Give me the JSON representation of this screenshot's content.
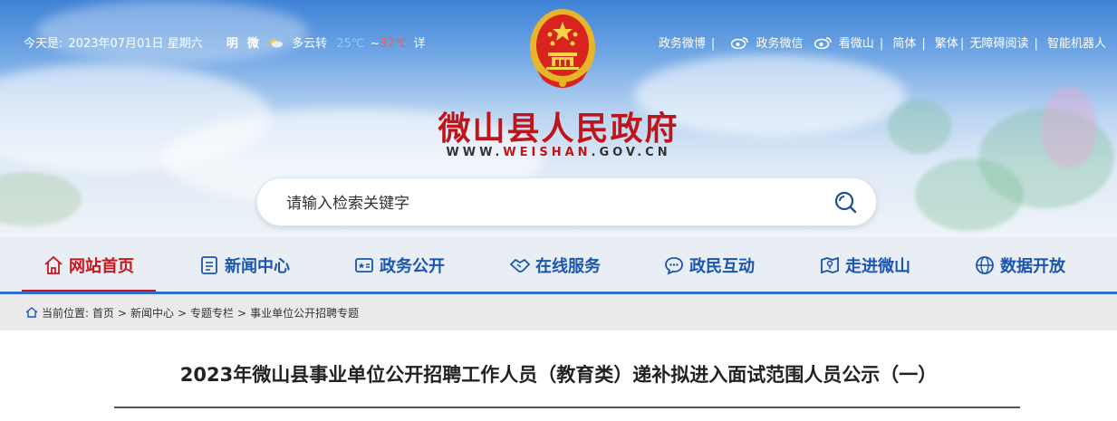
{
  "topbar": {
    "date_prefix": "今天是:",
    "date": "2023年07月01日 星期六",
    "city_part1": "明",
    "city_part2": "微",
    "weather": "多云转",
    "temp_low": "25℃",
    "temp_sep": "~",
    "temp_high": "32℃",
    "detail": "详",
    "links": [
      "政务微博",
      "政务微信",
      "看微山",
      "简体",
      "繁体",
      "无障碍阅读",
      "智能机器人"
    ]
  },
  "site": {
    "title": "微山县人民政府",
    "domain_prefix": "WWW.",
    "domain_highlight": "WEISHAN",
    "domain_suffix": ".GOV.CN"
  },
  "search": {
    "placeholder": "请输入检索关键字"
  },
  "nav": {
    "items": [
      {
        "label": "网站首页",
        "icon": "home-icon",
        "active": true
      },
      {
        "label": "新闻中心",
        "icon": "news-icon"
      },
      {
        "label": "政务公开",
        "icon": "open-gov-icon"
      },
      {
        "label": "在线服务",
        "icon": "handshake-icon"
      },
      {
        "label": "政民互动",
        "icon": "chat-icon"
      },
      {
        "label": "走进微山",
        "icon": "map-icon"
      },
      {
        "label": "数据开放",
        "icon": "globe-icon"
      }
    ]
  },
  "breadcrumb": {
    "prefix": "当前位置:",
    "items": [
      "首页",
      "新闻中心",
      "专题专栏",
      "事业单位公开招聘专题"
    ],
    "separator": ">"
  },
  "article": {
    "title": "2023年微山县事业单位公开招聘工作人员（教育类）递补拟进入面试范围人员公示（一）"
  },
  "colors": {
    "brand_red": "#c0141b",
    "nav_blue": "#1a55b0",
    "accent_blue": "#2f6fc9"
  }
}
